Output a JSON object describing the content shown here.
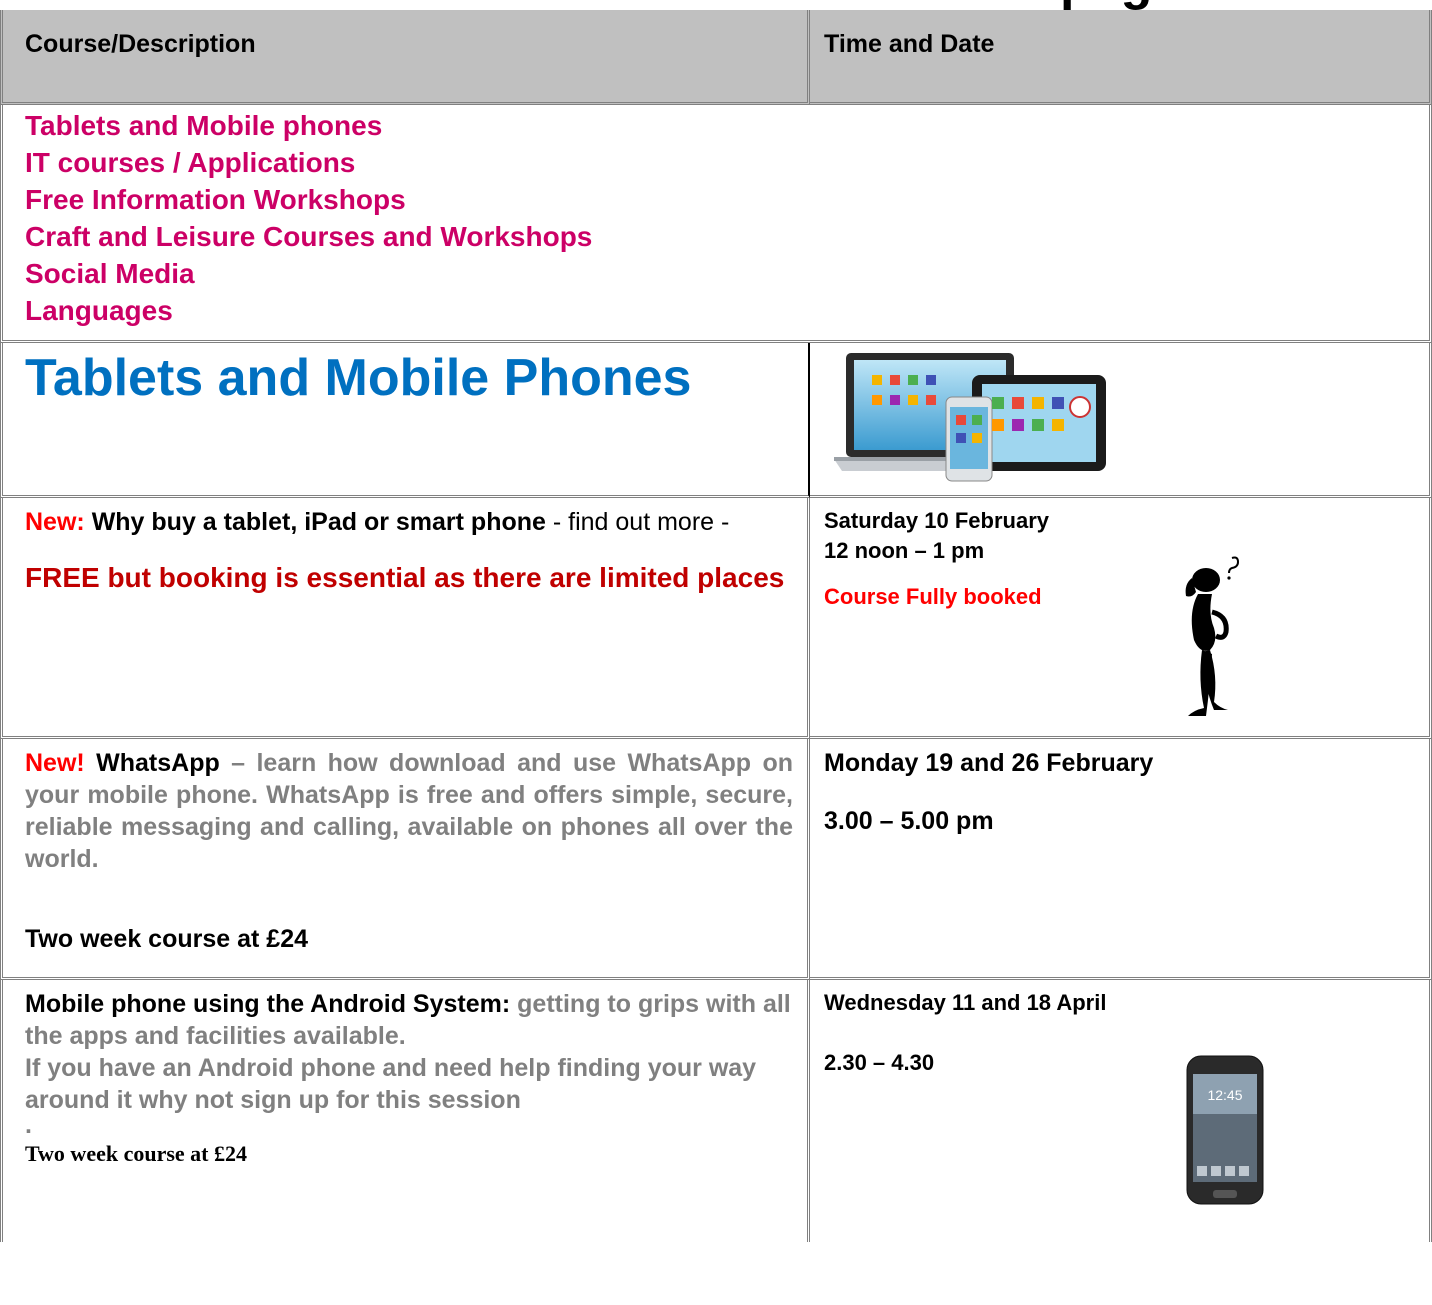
{
  "title_fragment": "pag",
  "header": {
    "col1": "Course/Description",
    "col2": "Time and Date"
  },
  "index": [
    "Tablets and Mobile phones",
    "IT courses / Applications",
    "Free Information Workshops",
    "Craft and Leisure Courses and Workshops",
    "Social Media",
    "Languages"
  ],
  "section": {
    "title": "Tablets and Mobile Phones",
    "image": "tablet-laptop-phone-devices"
  },
  "courses": [
    {
      "new_tag": "New:",
      "name": "Why buy a tablet, iPad or smart phone",
      "desc": " -  find out more  -",
      "note": "FREE but booking is essential as there are limited places",
      "date": "Saturday 10 February",
      "time": "12 noon – 1 pm",
      "status": "Course Fully booked",
      "image": "thinking-figure"
    },
    {
      "new_tag": "New!",
      "name": "WhatsApp",
      "desc": " – learn how download and use WhatsApp on your mobile phone. WhatsApp is free and offers simple, secure, reliable messaging and calling, available on phones all over the world.",
      "price": "Two week course at £24",
      "date": "Monday 19 and 26 February",
      "time": "3.00 – 5.00 pm"
    },
    {
      "name": "Mobile phone using the Android System:",
      "desc": " getting to grips with all the apps and facilities available.",
      "desc2": " If you have an Android phone and need help finding your way around it why not sign  up for this session",
      "dot": ".",
      "price": " Two week course at £24",
      "date": "Wednesday 11 and 18 April",
      "time": "2.30 – 4.30",
      "image": "samsung-phone"
    }
  ]
}
